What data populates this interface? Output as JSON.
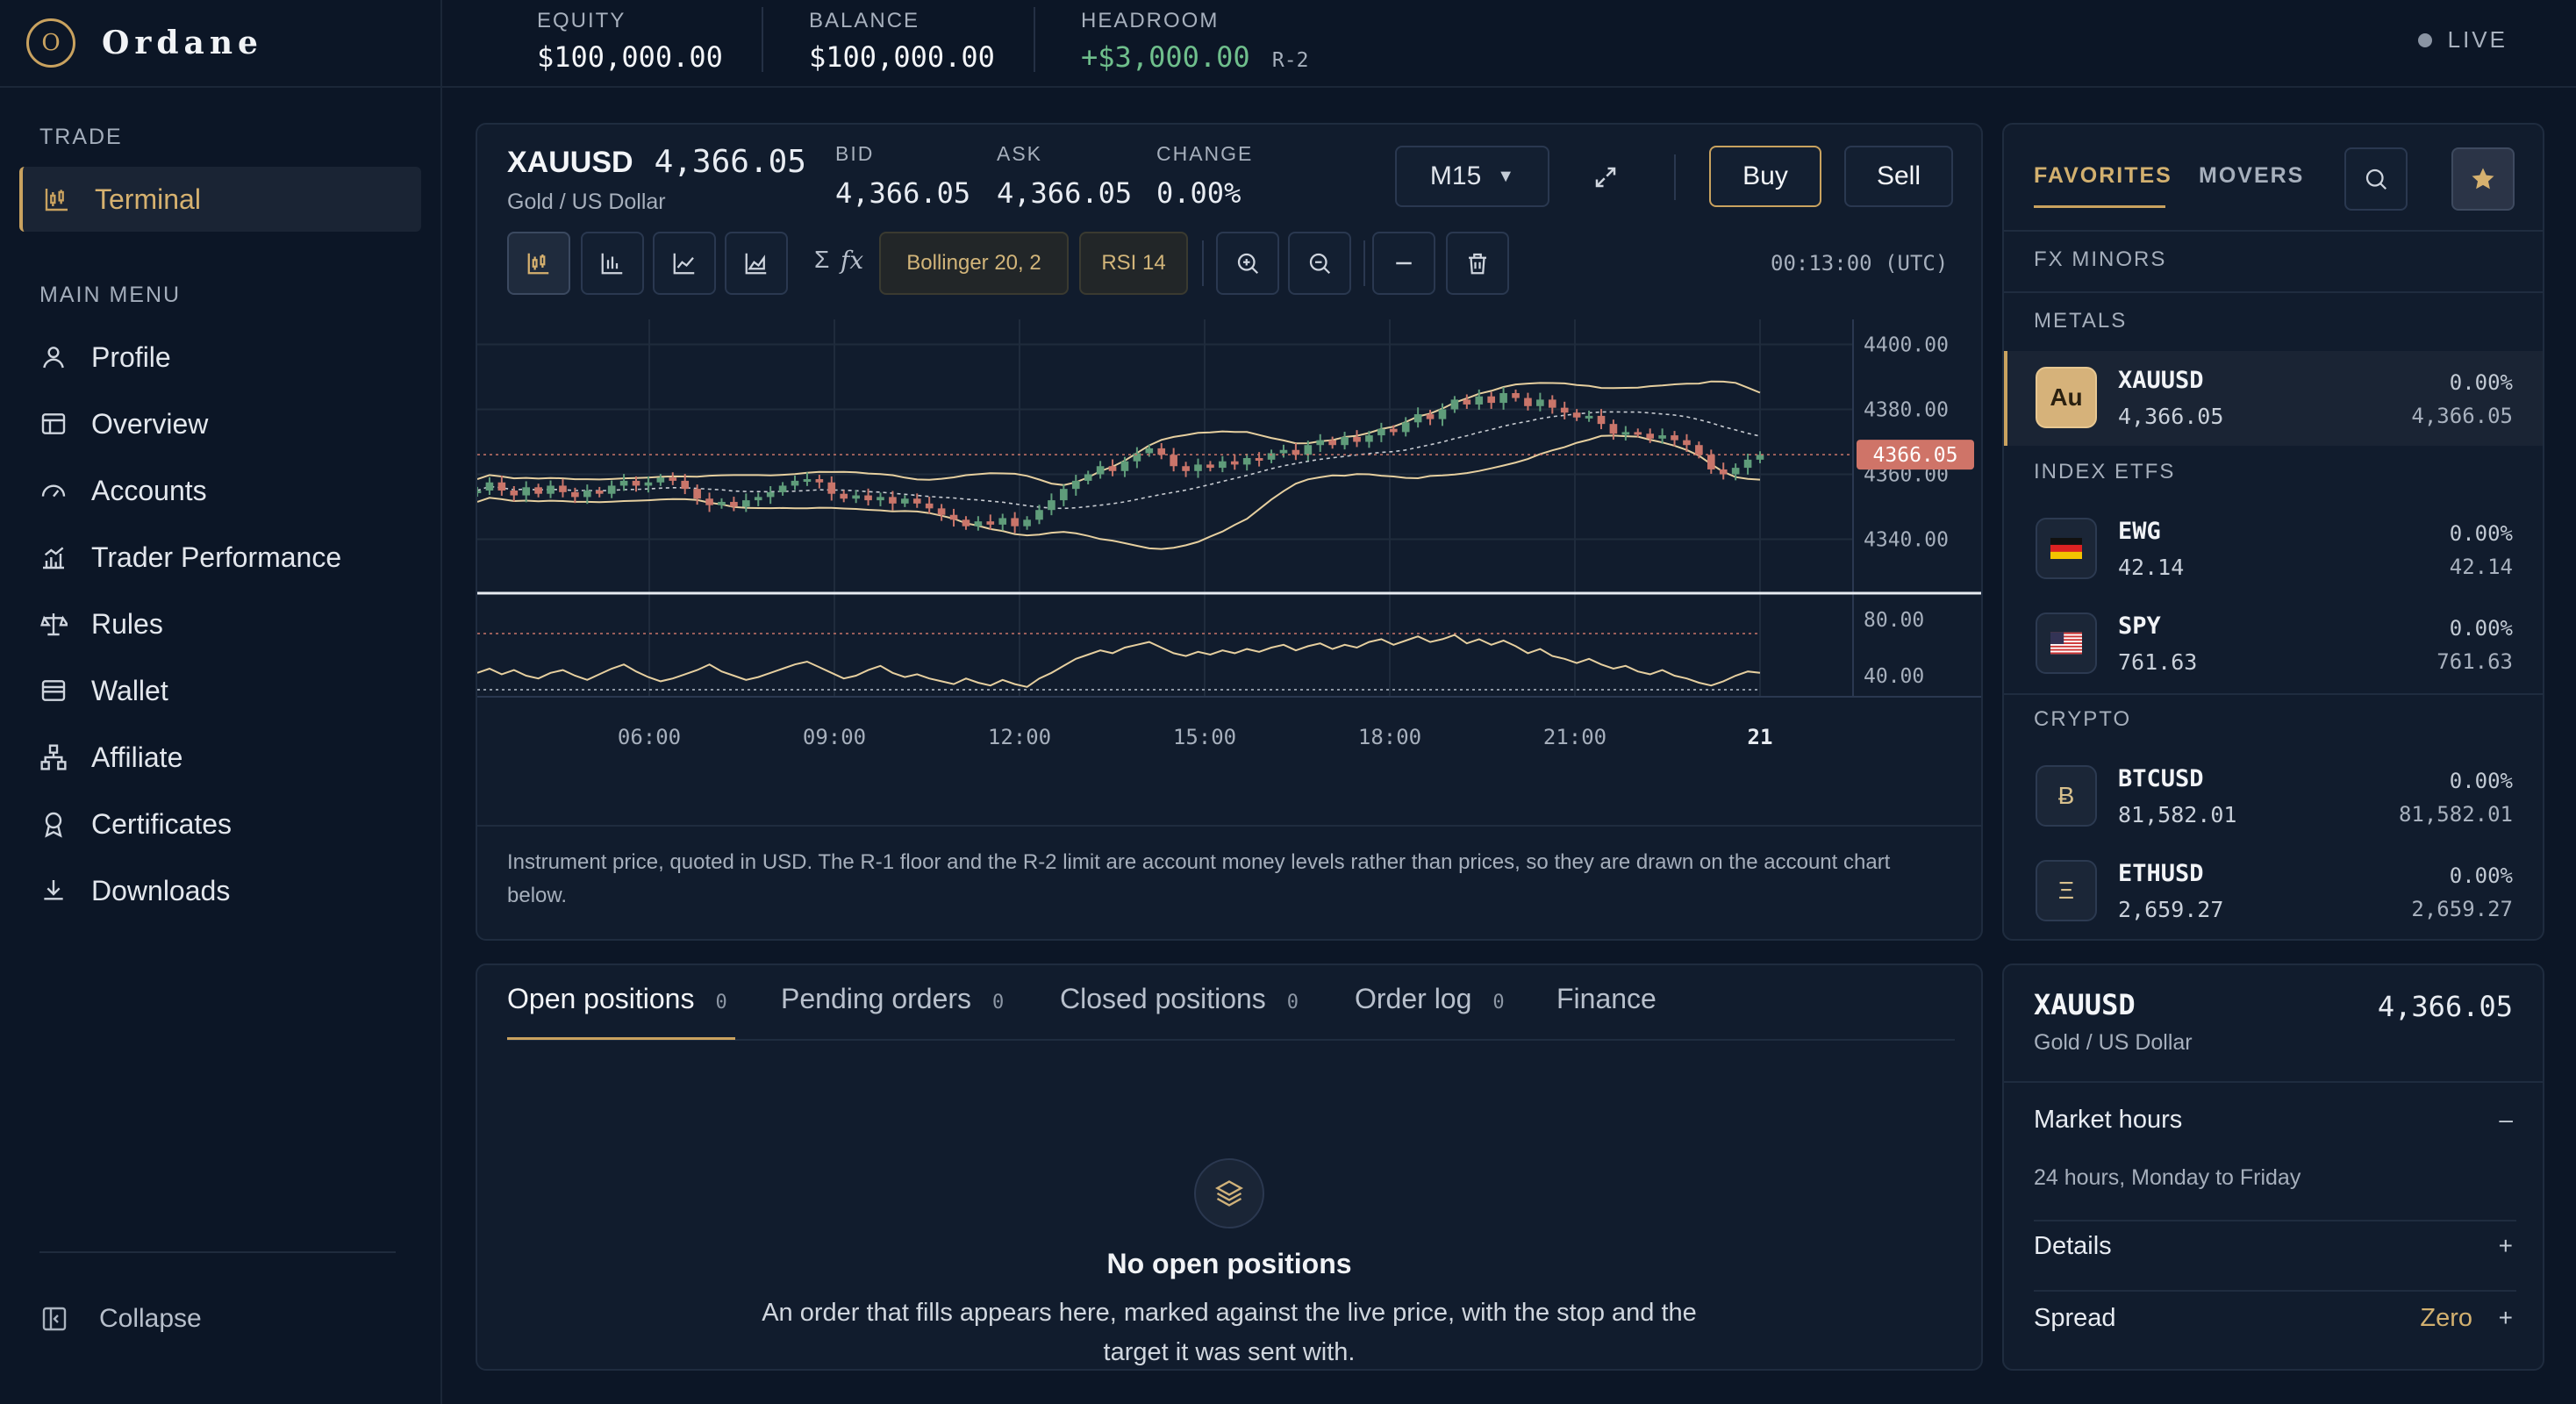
{
  "brand": {
    "logo_letter": "O",
    "name": "Ordane"
  },
  "sidebar": {
    "trade_label": "TRADE",
    "terminal": "Terminal",
    "main_menu_label": "MAIN MENU",
    "items": [
      {
        "label": "Profile",
        "icon": "user-icon"
      },
      {
        "label": "Overview",
        "icon": "layout-icon"
      },
      {
        "label": "Accounts",
        "icon": "gauge-icon"
      },
      {
        "label": "Trader Performance",
        "icon": "bar-chart-icon"
      },
      {
        "label": "Rules",
        "icon": "scale-icon"
      },
      {
        "label": "Wallet",
        "icon": "wallet-icon"
      },
      {
        "label": "Affiliate",
        "icon": "network-icon"
      },
      {
        "label": "Certificates",
        "icon": "award-icon"
      },
      {
        "label": "Downloads",
        "icon": "download-icon"
      }
    ],
    "collapse": "Collapse"
  },
  "topbar": {
    "equity_label": "EQUITY",
    "equity": "$100,000.00",
    "balance_label": "BALANCE",
    "balance": "$100,000.00",
    "headroom_label": "HEADROOM",
    "headroom": "+$3,000.00",
    "headroom_tag": "R-2",
    "live": "LIVE"
  },
  "chart_header": {
    "symbol": "XAUUSD",
    "price": "4,366.05",
    "name": "Gold / US Dollar",
    "bid_label": "BID",
    "bid": "4,366.05",
    "ask_label": "ASK",
    "ask": "4,366.05",
    "change_label": "CHANGE",
    "change": "0.00%",
    "timeframe": "M15",
    "buy": "Buy",
    "sell": "Sell",
    "sigma": "Σ",
    "fx": "fx",
    "bollinger": "Bollinger 20, 2",
    "rsi": "RSI 14",
    "clock": "00:13:00 (UTC)"
  },
  "chart_note": "Instrument price, quoted in USD. The R-1 floor and the R-2 limit are account money levels rather than prices, so they are drawn on the account chart below.",
  "chart_data": {
    "type": "candlestick",
    "x_ticks": [
      "06:00",
      "09:00",
      "12:00",
      "15:00",
      "18:00",
      "21:00",
      "21"
    ],
    "y_ticks": [
      4400,
      4380,
      4360,
      4340
    ],
    "y_tick_labels": [
      "4400.00",
      "4380.00",
      "4360.00",
      "4340.00"
    ],
    "ylim": [
      4325,
      4405
    ],
    "last_price": 4366.05,
    "last_price_label": "4366.05",
    "closes": [
      4355.0,
      4357.5,
      4355.0,
      4353.5,
      4356.0,
      4354.0,
      4356.5,
      4354.5,
      4353.0,
      4355.0,
      4354.0,
      4356.5,
      4358.0,
      4356.5,
      4357.5,
      4359.0,
      4358.0,
      4355.5,
      4352.5,
      4350.5,
      4351.5,
      4350.0,
      4352.0,
      4353.0,
      4354.5,
      4356.5,
      4358.0,
      4358.5,
      4357.5,
      4354.0,
      4352.5,
      4353.5,
      4352.0,
      4353.0,
      4351.0,
      4352.5,
      4351.0,
      4349.5,
      4347.5,
      4346.0,
      4344.0,
      4345.5,
      4344.5,
      4346.5,
      4344.0,
      4346.0,
      4349.0,
      4352.0,
      4355.5,
      4358.0,
      4360.0,
      4362.5,
      4361.0,
      4364.0,
      4366.5,
      4368.0,
      4366.0,
      4362.5,
      4361.0,
      4363.0,
      4362.0,
      4364.0,
      4363.0,
      4365.0,
      4364.5,
      4366.5,
      4367.5,
      4366.0,
      4369.0,
      4370.5,
      4369.0,
      4371.5,
      4370.0,
      4372.0,
      4374.0,
      4373.0,
      4376.0,
      4378.5,
      4377.0,
      4380.0,
      4383.0,
      4381.5,
      4384.0,
      4382.0,
      4385.0,
      4383.5,
      4381.0,
      4383.0,
      4380.5,
      4379.0,
      4377.5,
      4378.0,
      4375.5,
      4372.5,
      4373.0,
      4372.5,
      4371.0,
      4372.0,
      4370.5,
      4369.0,
      4366.0,
      4361.5,
      4360.0,
      4362.0,
      4364.5,
      4366.0
    ],
    "rsi": {
      "y_ticks": [
        80,
        40
      ],
      "y_tick_labels": [
        "80.00",
        "40.00"
      ],
      "ylim": [
        25,
        95
      ],
      "overbought": 70,
      "oversold": 30,
      "values": [
        42,
        45,
        41,
        44,
        40,
        38,
        42,
        44,
        40,
        37,
        41,
        45,
        48,
        43,
        39,
        36,
        38,
        41,
        44,
        48,
        43,
        40,
        37,
        39,
        42,
        45,
        48,
        50,
        46,
        42,
        38,
        40,
        44,
        47,
        42,
        39,
        41,
        38,
        36,
        34,
        38,
        35,
        33,
        37,
        34,
        32,
        38,
        42,
        47,
        52,
        55,
        58,
        56,
        60,
        62,
        64,
        60,
        56,
        54,
        57,
        55,
        58,
        56,
        59,
        57,
        60,
        62,
        58,
        61,
        63,
        59,
        62,
        60,
        64,
        66,
        62,
        65,
        68,
        64,
        66,
        69,
        63,
        66,
        62,
        65,
        61,
        56,
        59,
        54,
        52,
        49,
        52,
        48,
        45,
        47,
        43,
        41,
        44,
        40,
        38,
        35,
        33,
        36,
        40,
        43,
        42
      ]
    }
  },
  "positions": {
    "tabs": [
      {
        "label": "Open positions",
        "count": "0"
      },
      {
        "label": "Pending orders",
        "count": "0"
      },
      {
        "label": "Closed positions",
        "count": "0"
      },
      {
        "label": "Order log",
        "count": "0"
      },
      {
        "label": "Finance",
        "count": ""
      }
    ],
    "empty_title": "No open positions",
    "empty_desc": "An order that fills appears here, marked against the live price, with the stop and the target it was sent with."
  },
  "watchlist": {
    "tab_favorites": "FAVORITES",
    "tab_movers": "MOVERS",
    "fx_minors": "FX MINORS",
    "metals": "METALS",
    "index_etfs": "INDEX ETFS",
    "crypto": "CRYPTO",
    "xau": {
      "icon": "Au",
      "symbol": "XAUUSD",
      "price": "4,366.05",
      "change": "0.00%",
      "price2": "4,366.05"
    },
    "ewg": {
      "icon": "de-flag-icon",
      "symbol": "EWG",
      "price": "42.14",
      "change": "0.00%",
      "price2": "42.14"
    },
    "spy": {
      "icon": "us-flag-icon",
      "symbol": "SPY",
      "price": "761.63",
      "change": "0.00%",
      "price2": "761.63"
    },
    "btc": {
      "icon": "Ƀ",
      "symbol": "BTCUSD",
      "price": "81,582.01",
      "change": "0.00%",
      "price2": "81,582.01"
    },
    "eth": {
      "icon": "Ξ",
      "symbol": "ETHUSD",
      "price": "2,659.27",
      "change": "0.00%",
      "price2": "2,659.27"
    }
  },
  "instrument": {
    "symbol": "XAUUSD",
    "price": "4,366.05",
    "name": "Gold / US Dollar",
    "market_hours": "Market hours",
    "market_hours_sign": "–",
    "market_hours_value": "24 hours, Monday to Friday",
    "details": "Details",
    "details_sign": "+",
    "spread": "Spread",
    "spread_value": "Zero",
    "spread_sign": "+"
  },
  "colors": {
    "accent": "#c9a25f",
    "up": "#5f9c7a",
    "down": "#c9756a",
    "band": "#e6cf9f",
    "headroom": "#6fbf8c"
  }
}
